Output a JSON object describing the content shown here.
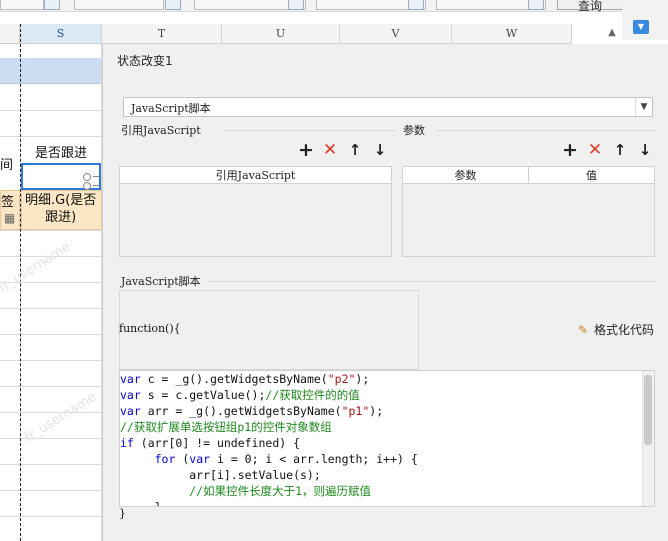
{
  "spreadsheet": {
    "query_button": "查询",
    "columns": [
      {
        "id": "S",
        "active": true
      },
      {
        "id": "T",
        "active": false
      },
      {
        "id": "U",
        "active": false
      },
      {
        "id": "V",
        "active": false
      },
      {
        "id": "W",
        "active": false
      }
    ],
    "cells": {
      "header_left": "间",
      "header_follow": "是否跟进",
      "row_left": "签",
      "follow_formula": "明细.G(是否\n跟进)"
    },
    "watermark": "fr_username"
  },
  "dialog": {
    "title": "状态改变1",
    "script_type": "JavaScript脚本",
    "ref_section": {
      "label": "引用JavaScript",
      "column": "引用JavaScript"
    },
    "param_section": {
      "label": "参数",
      "columns": [
        "参数",
        "值"
      ]
    },
    "script_section": {
      "label": "JavaScript脚本",
      "fn_open": "function(){",
      "fn_close": "}",
      "format_button": "格式化代码",
      "code_lines": [
        [
          {
            "t": "kw",
            "v": "var "
          },
          {
            "t": "plain",
            "v": "c = _g().getWidgetsByName("
          },
          {
            "t": "str",
            "v": "\"p2\""
          },
          {
            "t": "plain",
            "v": ");"
          }
        ],
        [
          {
            "t": "kw",
            "v": "var "
          },
          {
            "t": "plain",
            "v": "s = c.getValue();"
          },
          {
            "t": "cmt",
            "v": "//获取控件的的值"
          }
        ],
        [
          {
            "t": "kw",
            "v": "var "
          },
          {
            "t": "plain",
            "v": "arr = _g().getWidgetsByName("
          },
          {
            "t": "str",
            "v": "\"p1\""
          },
          {
            "t": "plain",
            "v": ");"
          }
        ],
        [
          {
            "t": "cmt",
            "v": "//获取扩展单选按钮组p1的控件对象数组"
          }
        ],
        [
          {
            "t": "kw",
            "v": "if "
          },
          {
            "t": "plain",
            "v": "(arr[0] != undefined) {"
          }
        ],
        [
          {
            "t": "plain",
            "v": "     "
          },
          {
            "t": "kw",
            "v": "for "
          },
          {
            "t": "plain",
            "v": "("
          },
          {
            "t": "kw",
            "v": "var "
          },
          {
            "t": "plain",
            "v": "i = 0; i < arr.length; i++) {"
          }
        ],
        [
          {
            "t": "plain",
            "v": "          arr[i].setValue(s);"
          }
        ],
        [
          {
            "t": "plain",
            "v": "          "
          },
          {
            "t": "cmt",
            "v": "//如果控件长度大于1，则遍历赋值"
          }
        ],
        [
          {
            "t": "plain",
            "v": "     }"
          }
        ]
      ]
    },
    "icons": [
      "plus-icon",
      "delete-icon",
      "arrow-up-icon",
      "arrow-down-icon"
    ]
  },
  "colors": {
    "accent": "#2f7ad6",
    "delete": "#e23a2a",
    "keyword": "#0000cc",
    "string": "#a31515",
    "comment": "#1f8a1f"
  }
}
